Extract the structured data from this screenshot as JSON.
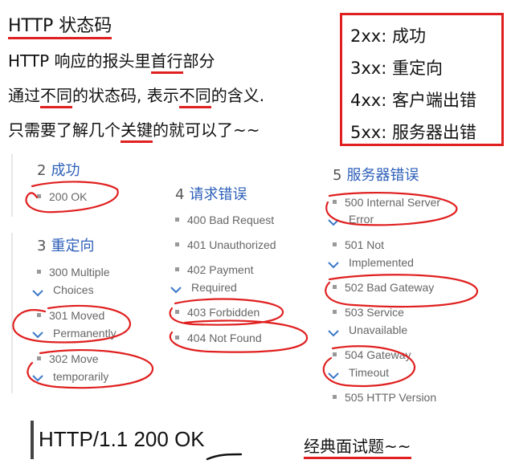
{
  "intro": {
    "title": "HTTP 状态码",
    "line1": "HTTP 响应的报头里首行部分",
    "line2": "通过不同的状态码, 表示不同的含义.",
    "line3": "只需要了解几个关键的就可以了~~"
  },
  "status_classes": [
    "2xx: 成功",
    "3xx: 重定向",
    "4xx: 客户端出错",
    "5xx: 服务器出错"
  ],
  "sections": {
    "s2": {
      "num": "2",
      "title": "成功",
      "items": [
        "200 OK"
      ]
    },
    "s3": {
      "num": "3",
      "title": "重定向",
      "items": [
        "300 Multiple",
        "Choices",
        "301 Moved",
        "Permanently",
        "302 Move",
        "temporarily"
      ]
    },
    "s4": {
      "num": "4",
      "title": "请求错误",
      "items": [
        "400 Bad Request",
        "401 Unauthorized",
        "402 Payment",
        "Required",
        "403 Forbidden",
        "404 Not Found"
      ]
    },
    "s5": {
      "num": "5",
      "title": "服务器错误",
      "items": [
        "500 Internal Server",
        "Error",
        "501 Not",
        "Implemented",
        "502 Bad Gateway",
        "503 Service",
        "Unavailable",
        "504 Gateway",
        "Timeout",
        "505 HTTP Version"
      ]
    }
  },
  "bottom": {
    "http_line": "HTTP/1.1 200 OK",
    "classic": "经典面试题~~"
  },
  "colors": {
    "accent_red": "#e02020",
    "link_blue": "#2c5fb8"
  }
}
